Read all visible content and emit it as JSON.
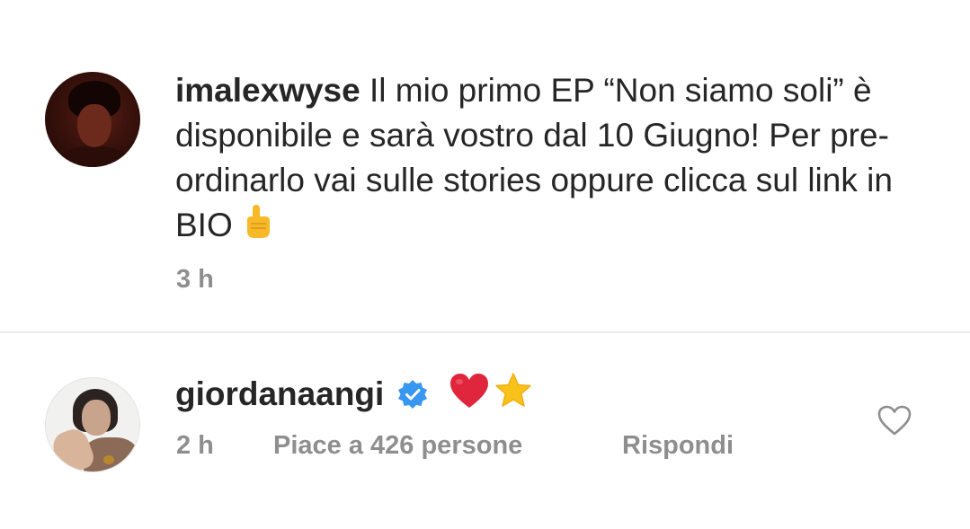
{
  "caption": {
    "username": "imalexwyse",
    "text": "Il mio primo EP “Non siamo soli” è disponibile e sarà vostro dal 10 Giugno! Per pre-ordinarlo vai sulle stories oppure clicca sul link in BIO",
    "emoji": "☝️",
    "time": "3 h"
  },
  "comment": {
    "username": "giordanaangi",
    "verified": true,
    "emojis": [
      "❤️",
      "⭐"
    ],
    "time": "2 h",
    "likes": "Piace a 426 persone",
    "reply_label": "Rispondi"
  },
  "icons": {
    "verified": "verified-badge-icon",
    "like": "heart-outline-icon"
  },
  "colors": {
    "verified_blue": "#3897f0",
    "heart_red": "#e0263c",
    "star_yellow": "#f9c21b",
    "secondary_text": "#8e8e8e",
    "primary_text": "#262626"
  }
}
